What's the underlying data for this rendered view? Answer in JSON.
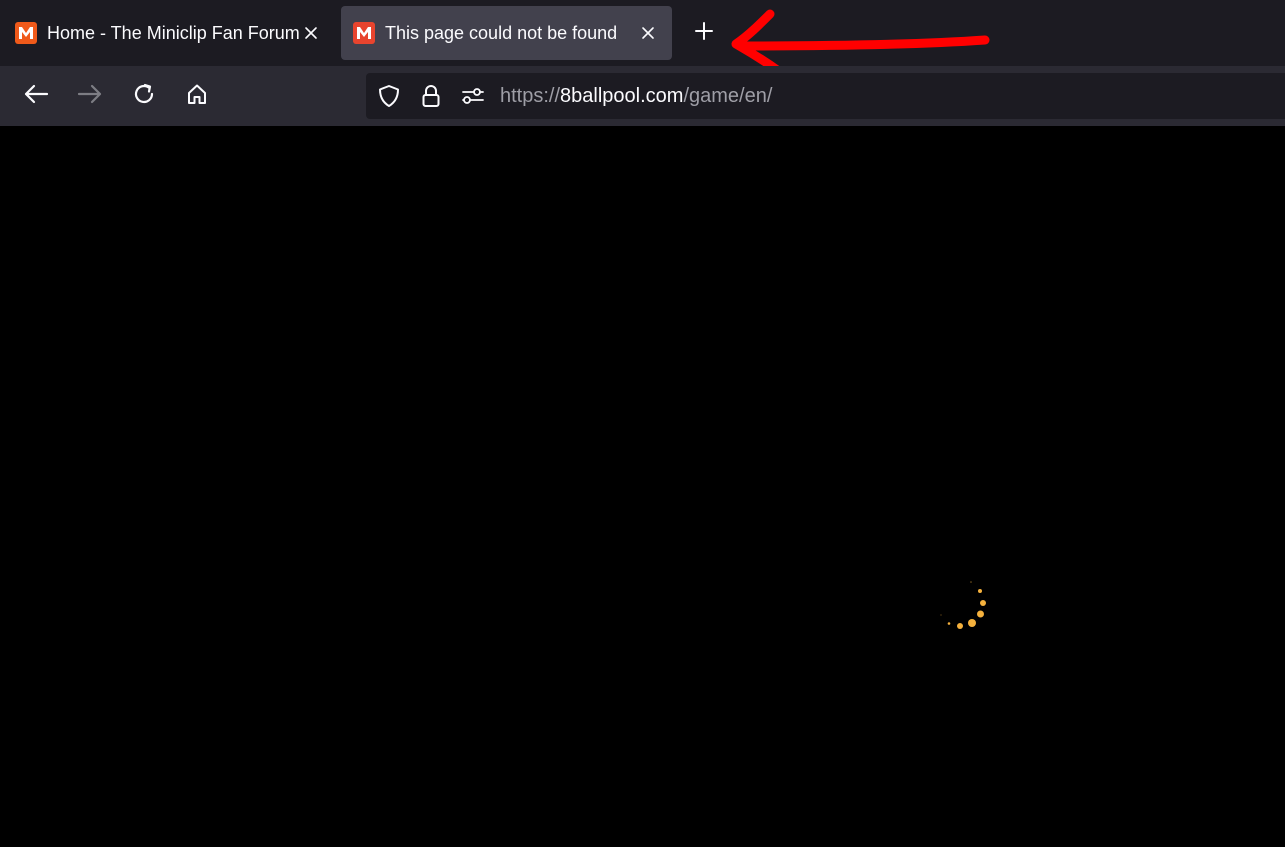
{
  "browser": {
    "tabs": [
      {
        "title": "Home - The Miniclip Fan Forum",
        "favicon": "miniclip-logo",
        "active": false
      },
      {
        "title": "This page could not be found",
        "favicon": "miniclip-logo",
        "active": true
      }
    ],
    "new_tab_icon": "plus-icon",
    "nav_icons": [
      "back-arrow-icon",
      "forward-arrow-icon",
      "reload-icon",
      "home-icon"
    ],
    "url": {
      "scheme": "https://",
      "host": "8ballpool.com",
      "path": "/game/en/"
    },
    "url_icons": [
      "shield-icon",
      "lock-icon",
      "permissions-icon"
    ]
  },
  "content": {
    "state": "loading",
    "spinner_icon": "loading-spinner-icon",
    "spinner_color": "#f5b13d"
  },
  "annotation": {
    "type": "red-arrow",
    "color": "#ff0000",
    "points_to": "new-tab-button"
  },
  "colors": {
    "tabstrip_bg": "#1c1b22",
    "active_tab_bg": "#42414d",
    "toolbar_bg": "#2b2a33",
    "urlbar_bg": "#1c1b22",
    "content_bg": "#000000"
  }
}
